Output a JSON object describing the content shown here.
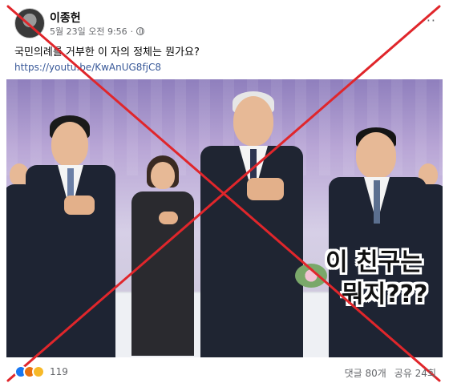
{
  "post": {
    "author": "이종헌",
    "timestamp": "5월 23일 오전 9:56",
    "separator": "·",
    "privacy_icon": "globe-icon",
    "more_icon": "more-icon",
    "text": "국민의례를 거부한 이 자의 정체는 뭔가요?",
    "link": "https://youtu.be/KwAnUG8fjC8"
  },
  "photo": {
    "overlay_line1": "이 친구는",
    "overlay_line2": "뭐지???",
    "cross_color": "#e0262b"
  },
  "footer": {
    "reaction_icons": [
      "like-icon",
      "angry-icon",
      "haha-icon"
    ],
    "reaction_count": "119",
    "comments": "댓글 80개",
    "shares": "공유 24회"
  }
}
